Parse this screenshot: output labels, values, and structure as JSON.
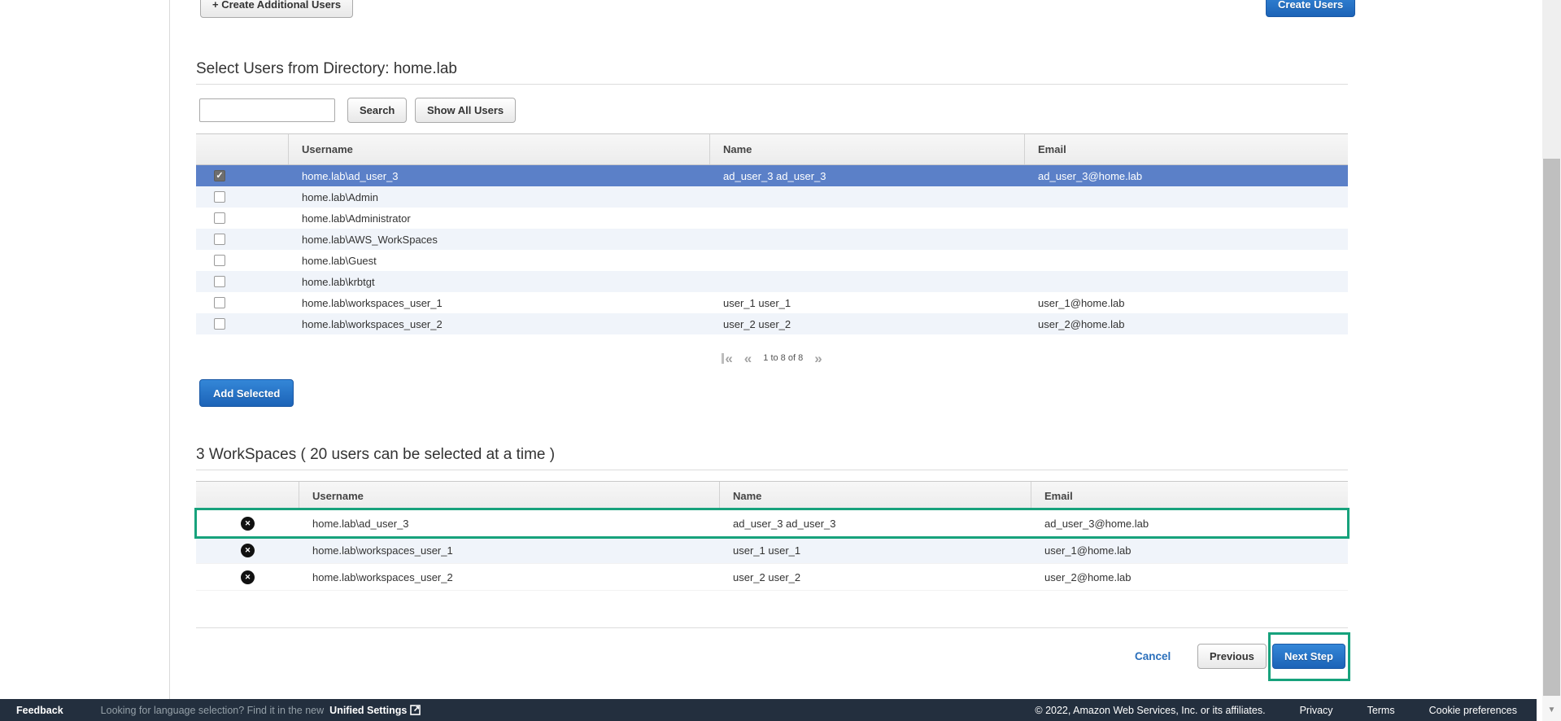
{
  "topbar": {
    "create_additional_users_label": "+ Create Additional Users",
    "create_users_label": "Create Users"
  },
  "directory_section": {
    "heading": "Select Users from Directory: home.lab",
    "search": {
      "value": "",
      "placeholder": ""
    },
    "search_button_label": "Search",
    "show_all_users_button_label": "Show All Users",
    "table": {
      "columns": [
        "Username",
        "Name",
        "Email"
      ],
      "rows": [
        {
          "username": "home.lab\\ad_user_3",
          "name": "ad_user_3 ad_user_3",
          "email": "ad_user_3@home.lab",
          "selected": true
        },
        {
          "username": "home.lab\\Admin",
          "name": "",
          "email": "",
          "selected": false
        },
        {
          "username": "home.lab\\Administrator",
          "name": "",
          "email": "",
          "selected": false
        },
        {
          "username": "home.lab\\AWS_WorkSpaces",
          "name": "",
          "email": "",
          "selected": false
        },
        {
          "username": "home.lab\\Guest",
          "name": "",
          "email": "",
          "selected": false
        },
        {
          "username": "home.lab\\krbtgt",
          "name": "",
          "email": "",
          "selected": false
        },
        {
          "username": "home.lab\\workspaces_user_1",
          "name": "user_1 user_1",
          "email": "user_1@home.lab",
          "selected": false
        },
        {
          "username": "home.lab\\workspaces_user_2",
          "name": "user_2 user_2",
          "email": "user_2@home.lab",
          "selected": false
        }
      ],
      "pagination_text": "1 to 8 of 8"
    },
    "add_selected_button_label": "Add Selected"
  },
  "workspaces_section": {
    "heading": "3 WorkSpaces ( 20 users can be selected at a time )",
    "table": {
      "columns": [
        "Username",
        "Name",
        "Email"
      ],
      "rows": [
        {
          "username": "home.lab\\ad_user_3",
          "name": "ad_user_3 ad_user_3",
          "email": "ad_user_3@home.lab",
          "highlighted": true
        },
        {
          "username": "home.lab\\workspaces_user_1",
          "name": "user_1 user_1",
          "email": "user_1@home.lab",
          "highlighted": false
        },
        {
          "username": "home.lab\\workspaces_user_2",
          "name": "user_2 user_2",
          "email": "user_2@home.lab",
          "highlighted": false
        }
      ]
    }
  },
  "wizard_actions": {
    "cancel_label": "Cancel",
    "previous_label": "Previous",
    "next_step_label": "Next Step"
  },
  "footer": {
    "feedback_label": "Feedback",
    "language_hint": "Looking for language selection? Find it in the new",
    "unified_settings_label": "Unified Settings",
    "copyright": "© 2022, Amazon Web Services, Inc. or its affiliates.",
    "privacy_label": "Privacy",
    "terms_label": "Terms",
    "cookie_preferences_label": "Cookie preferences"
  },
  "colors": {
    "selected_row_blue": "#5b80c8",
    "primary_button_blue": "#1c63b7",
    "annotation_green": "#17a27c",
    "footer_background": "#232f3e",
    "link_blue": "#2a6fbb",
    "alt_row_tint": "#f0f4fa"
  }
}
